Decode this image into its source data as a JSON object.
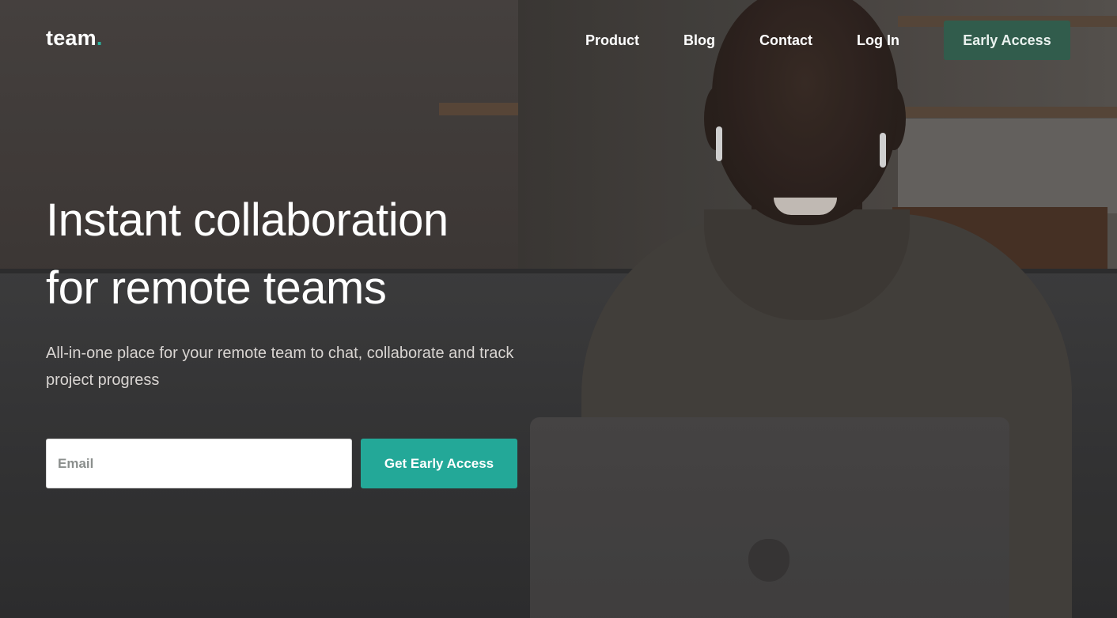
{
  "brand": {
    "name": "team",
    "dot": ".",
    "accent": "#2bb39f"
  },
  "nav": {
    "links": [
      "Product",
      "Blog",
      "Contact",
      "Log In"
    ],
    "cta_label": "Early Access",
    "cta_color": "#315c4c"
  },
  "hero": {
    "title_line1": "Instant collaboration",
    "title_line2": "for remote teams",
    "subtitle": "All-in-one place for your remote team to chat, collaborate and track project progress"
  },
  "signup": {
    "email_placeholder": "Email",
    "button_label": "Get Early Access",
    "button_color": "#23a898"
  },
  "background": {
    "image": "photo of smiling man with earbuds using a laptop on a sofa"
  }
}
